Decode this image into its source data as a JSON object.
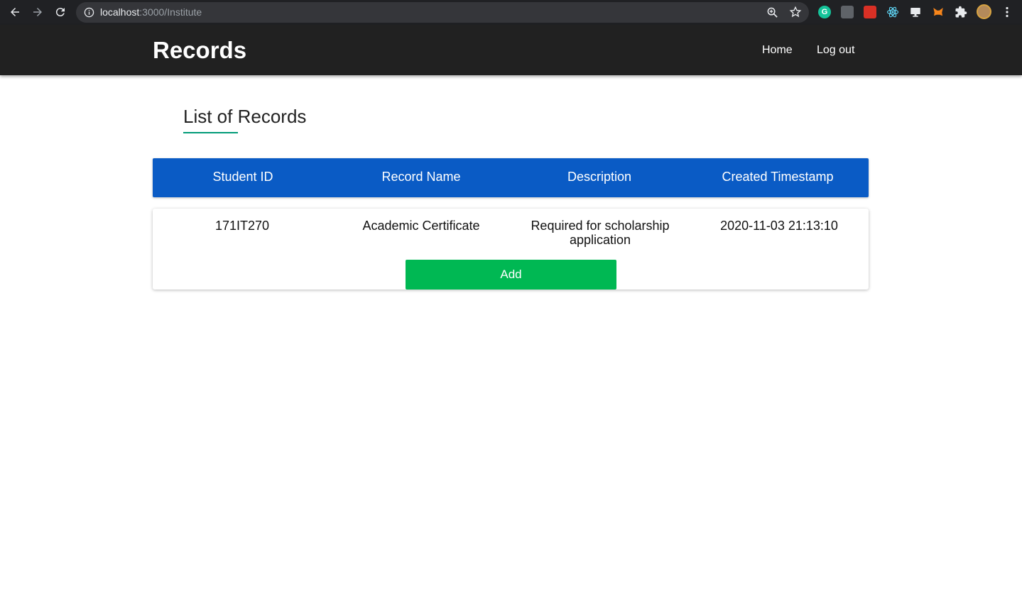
{
  "browser": {
    "url_host": "localhost",
    "url_rest": ":3000/Institute",
    "grammarly_letter": "G"
  },
  "appbar": {
    "title": "Records",
    "nav": [
      "Home",
      "Log out"
    ]
  },
  "main": {
    "heading": "List of Records",
    "columns": [
      "Student ID",
      "Record Name",
      "Description",
      "Created Timestamp"
    ],
    "rows": [
      {
        "student_id": "171IT270",
        "record_name": "Academic Certificate",
        "description_line1": "Required for scholarship",
        "description_line2": "application",
        "created": "2020-11-03 21:13:10"
      }
    ],
    "add_label": "Add"
  },
  "colors": {
    "appbar": "#212121",
    "header_blue": "#0a5bc5",
    "add_green": "#00b853",
    "underline_teal": "#009b77"
  },
  "icons": [
    "back-arrow-icon",
    "forward-arrow-icon",
    "reload-icon",
    "info-icon",
    "zoom-icon",
    "star-icon",
    "grammarly-icon",
    "extension-icon",
    "react-devtools-icon",
    "monitor-icon",
    "metamask-icon",
    "puzzle-icon",
    "profile-avatar",
    "kebab-menu-icon"
  ]
}
